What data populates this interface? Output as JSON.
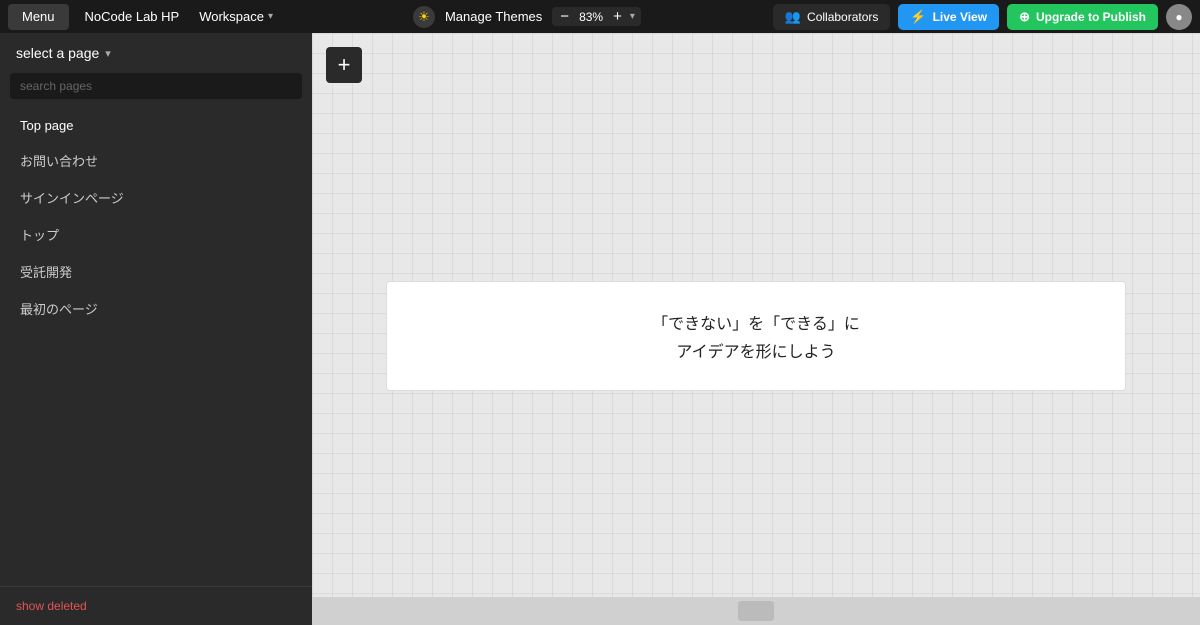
{
  "topbar": {
    "menu_label": "Menu",
    "appname": "NoCode Lab HP",
    "workspace_label": "Workspace",
    "manage_themes_label": "Manage Themes",
    "zoom_level": "83%",
    "collaborators_label": "Collaborators",
    "live_view_label": "Live View",
    "publish_label": "Upgrade to Publish"
  },
  "sidebar": {
    "header_label": "select a page",
    "search_placeholder": "search pages",
    "pages": [
      {
        "label": "Top page",
        "active": true
      },
      {
        "label": "お問い合わせ",
        "active": false
      },
      {
        "label": "サインインページ",
        "active": false
      },
      {
        "label": "トップ",
        "active": false
      },
      {
        "label": "受託開発",
        "active": false
      },
      {
        "label": "最初のページ",
        "active": false
      }
    ],
    "show_deleted_label": "show deleted"
  },
  "canvas": {
    "add_btn_label": "+",
    "block": {
      "line1": "「できない」を「できる」に",
      "line2": "アイデアを形にしよう"
    }
  }
}
